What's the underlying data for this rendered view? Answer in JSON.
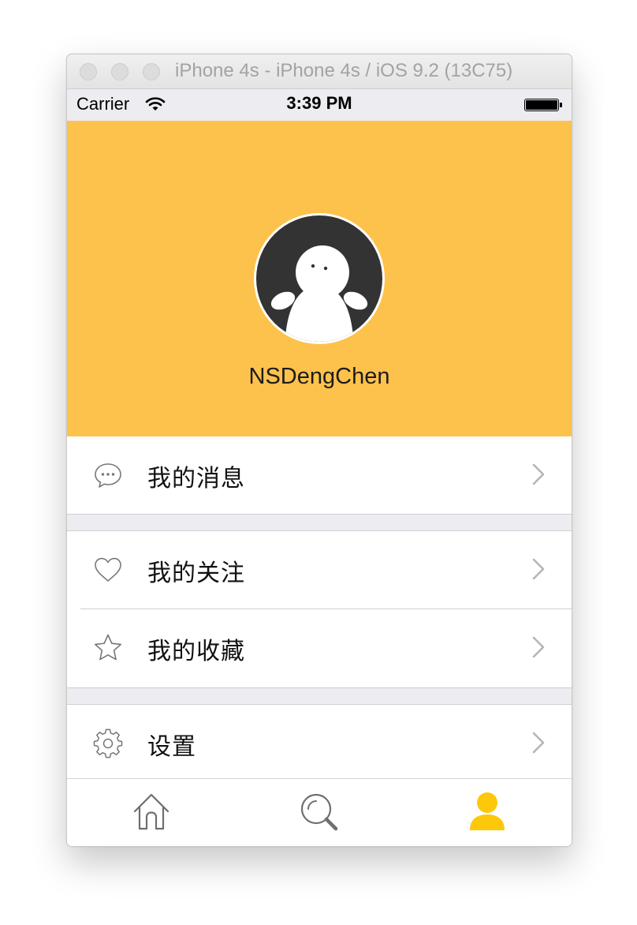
{
  "window": {
    "title": "iPhone 4s - iPhone 4s / iOS 9.2 (13C75)"
  },
  "statusbar": {
    "carrier": "Carrier",
    "time": "3:39 PM"
  },
  "profile": {
    "username": "NSDengChen"
  },
  "menu": {
    "messages": {
      "label": "我的消息",
      "icon": "chat-bubble-icon"
    },
    "follows": {
      "label": "我的关注",
      "icon": "heart-icon"
    },
    "favorites": {
      "label": "我的收藏",
      "icon": "star-icon"
    },
    "settings": {
      "label": "设置",
      "icon": "gear-icon"
    }
  },
  "tabbar": {
    "tabs": [
      {
        "icon": "home-icon",
        "active": false
      },
      {
        "icon": "search-icon",
        "active": false
      },
      {
        "icon": "profile-icon",
        "active": true
      }
    ]
  },
  "colors": {
    "header_bg": "#fdc24c",
    "active_tab": "#fdc80a",
    "inactive_tab": "#6f6f6f",
    "group_gap": "#ececf1"
  }
}
